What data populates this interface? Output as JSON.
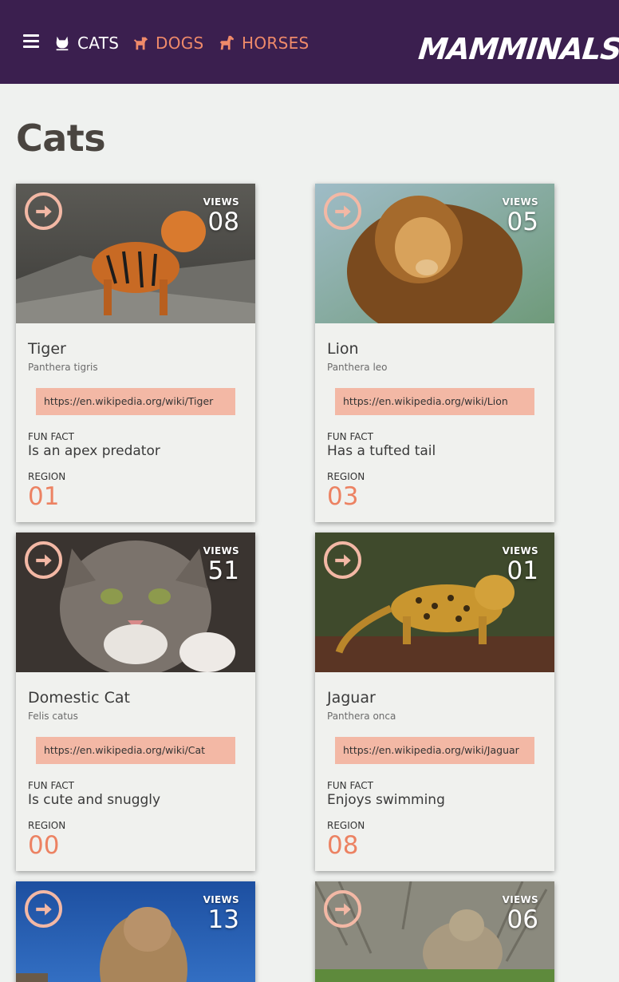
{
  "nav": {
    "items": [
      {
        "label": "CATS",
        "icon": "cat-icon"
      },
      {
        "label": "DOGS",
        "icon": "dog-icon"
      },
      {
        "label": "HORSES",
        "icon": "horse-icon"
      }
    ],
    "logo": "MAMMINALS",
    "logo_bang": "!"
  },
  "colors": {
    "nav_background": "#3b1f4f",
    "accent": "#ec8262",
    "link_background": "#f3b8a5",
    "page_background": "#eff1ef"
  },
  "page": {
    "title": "Cats"
  },
  "labels": {
    "views": "VIEWS",
    "fun_fact": "FUN FACT",
    "region": "REGION"
  },
  "cards": [
    {
      "name": "Tiger",
      "scientific": "Panthera tigris",
      "link": "https://en.wikipedia.org/wiki/Tiger",
      "fact": "Is an apex predator",
      "region": "01",
      "views": "08"
    },
    {
      "name": "Lion",
      "scientific": "Panthera leo",
      "link": "https://en.wikipedia.org/wiki/Lion",
      "fact": "Has a tufted tail",
      "region": "03",
      "views": "05"
    },
    {
      "name": "Domestic Cat",
      "scientific": "Felis catus",
      "link": "https://en.wikipedia.org/wiki/Cat",
      "fact": "Is cute and snuggly",
      "region": "00",
      "views": "51"
    },
    {
      "name": "Jaguar",
      "scientific": "Panthera onca",
      "link": "https://en.wikipedia.org/wiki/Jaguar",
      "fact": "Enjoys swimming",
      "region": "08",
      "views": "01"
    },
    {
      "views": "13"
    },
    {
      "views": "06"
    }
  ]
}
